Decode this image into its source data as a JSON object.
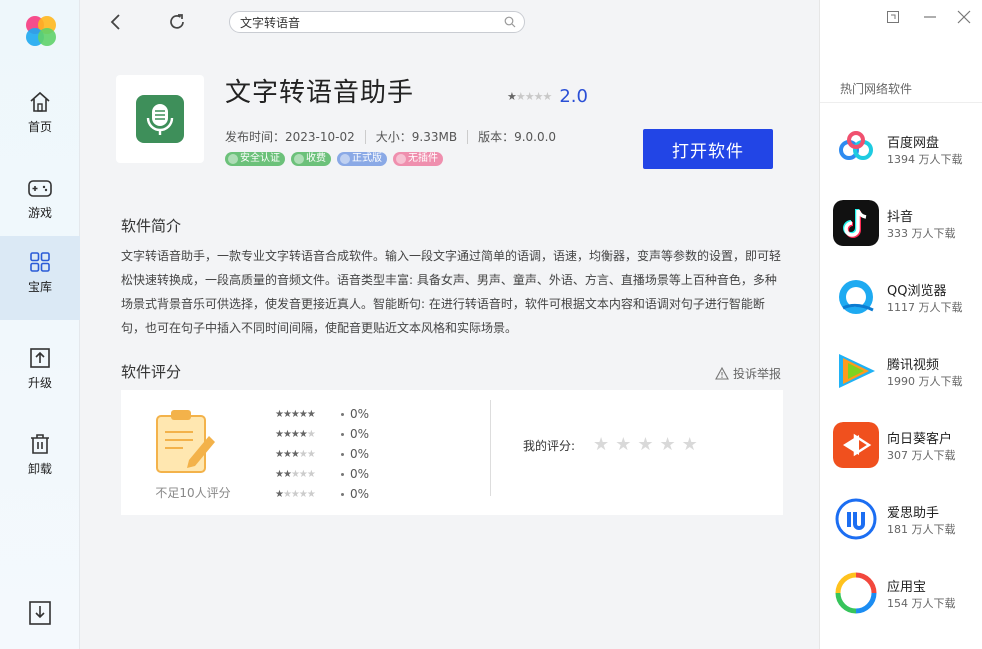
{
  "sidebar": {
    "items": [
      {
        "label": "首页",
        "icon": "home-icon"
      },
      {
        "label": "游戏",
        "icon": "gamepad-icon"
      },
      {
        "label": "宝库",
        "icon": "grid-icon"
      },
      {
        "label": "升级",
        "icon": "upgrade-icon"
      },
      {
        "label": "卸载",
        "icon": "trash-icon"
      }
    ],
    "active": "宝库"
  },
  "search": {
    "value": "文字转语音"
  },
  "app": {
    "title": "文字转语音助手",
    "score": "2.0",
    "release_date": "发布时间：2023-10-02",
    "size": "大小：9.33MB",
    "version": "版本：9.0.0.0",
    "badges": [
      {
        "label": "安全认证",
        "color": "#6cc17a"
      },
      {
        "label": "收费",
        "color": "#6cc17a"
      },
      {
        "label": "正式版",
        "color": "#8aa9e6"
      },
      {
        "label": "无插件",
        "color": "#ef8fae"
      }
    ],
    "open_button": "打开软件",
    "icon_color": "#3e8f5a"
  },
  "intro": {
    "title": "软件简介",
    "text": "文字转语音助手，一款专业文字转语音合成软件。输入一段文字通过简单的语调，语速，均衡器，变声等参数的设置，即可轻松快速转换成，一段高质量的音频文件。语音类型丰富: 具备女声、男声、童声、外语、方言、直播场景等上百种音色，多种场景式背景音乐可供选择，使发音更接近真人。智能断句: 在进行转语音时，软件可根据文本内容和语调对句子进行智能断句，也可在句子中插入不同时间间隔，使配音更贴近文本风格和实际场景。"
  },
  "rating": {
    "title": "软件评分",
    "report": "投诉举报",
    "few_text": "不足10人评分",
    "distribution": [
      {
        "stars": 5,
        "pct": "0%"
      },
      {
        "stars": 4,
        "pct": "0%"
      },
      {
        "stars": 3,
        "pct": "0%"
      },
      {
        "stars": 2,
        "pct": "0%"
      },
      {
        "stars": 1,
        "pct": "0%"
      }
    ],
    "my_rating_label": "我的评分:"
  },
  "hot": {
    "title": "热门网络软件",
    "items": [
      {
        "name": "百度网盘",
        "downloads": "1394 万人下载",
        "icon": "baidu-netdisk-icon",
        "color": "#ffffff"
      },
      {
        "name": "抖音",
        "downloads": "333 万人下载",
        "icon": "douyin-icon",
        "color": "#111111"
      },
      {
        "name": "QQ浏览器",
        "downloads": "1117 万人下载",
        "icon": "qq-browser-icon",
        "color": "#ffffff"
      },
      {
        "name": "腾讯视频",
        "downloads": "1990 万人下载",
        "icon": "tencent-video-icon",
        "color": "#ffffff"
      },
      {
        "name": "向日葵客户",
        "downloads": "307 万人下载",
        "icon": "sunlogin-icon",
        "color": "#f0501e"
      },
      {
        "name": "爱思助手",
        "downloads": "181 万人下载",
        "icon": "i4-icon",
        "color": "#ffffff"
      },
      {
        "name": "应用宝",
        "downloads": "154 万人下载",
        "icon": "yingyongbao-icon",
        "color": "#ffffff"
      }
    ]
  }
}
